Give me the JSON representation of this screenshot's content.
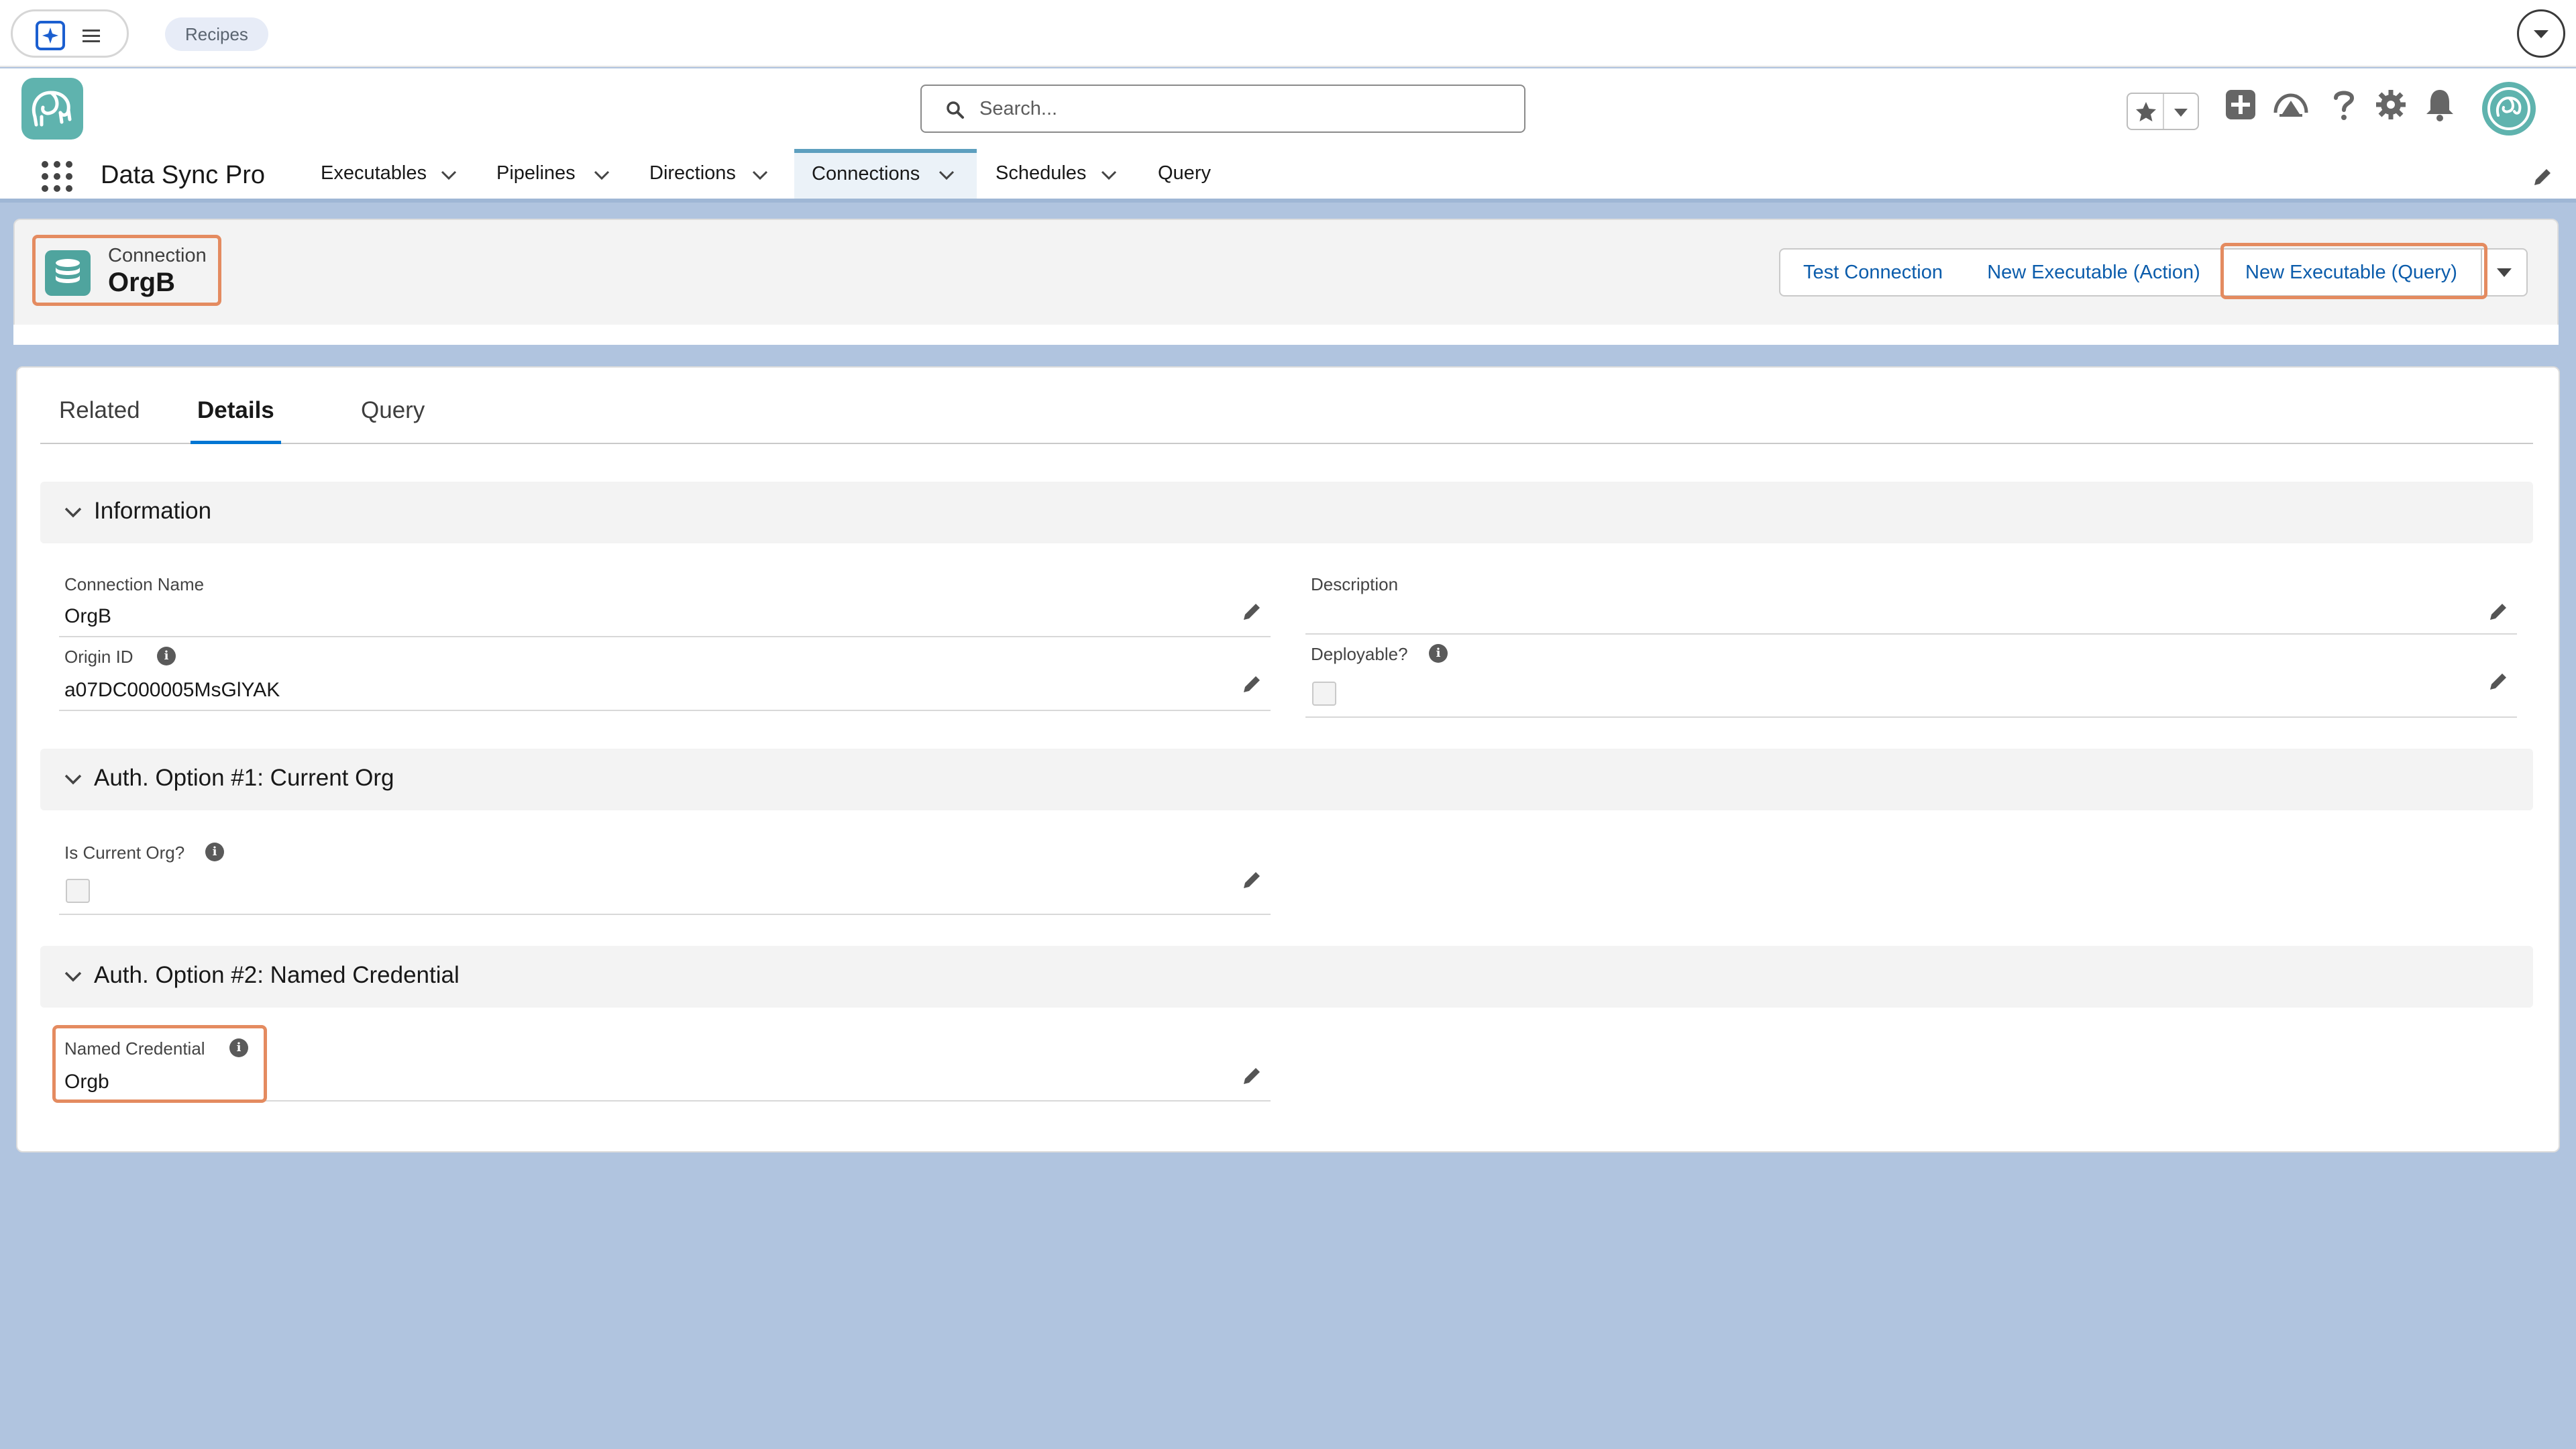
{
  "browser": {
    "chip_label": "Recipes",
    "icons": [
      "extension-logo-icon",
      "menu-icon",
      "chevron-down-icon"
    ]
  },
  "header": {
    "search_placeholder": "Search...",
    "icons": [
      "star-icon",
      "add-icon",
      "trailhead-icon",
      "help-icon",
      "gear-icon",
      "bell-icon"
    ]
  },
  "nav": {
    "app_name": "Data Sync Pro",
    "items": [
      {
        "label": "Executables",
        "has_menu": true,
        "active": false
      },
      {
        "label": "Pipelines",
        "has_menu": true,
        "active": false
      },
      {
        "label": "Directions",
        "has_menu": true,
        "active": false
      },
      {
        "label": "Connections",
        "has_menu": true,
        "active": true
      },
      {
        "label": "Schedules",
        "has_menu": true,
        "active": false
      },
      {
        "label": "Query",
        "has_menu": false,
        "active": false
      }
    ]
  },
  "record": {
    "type_label": "Connection",
    "name": "OrgB",
    "actions": {
      "test": "Test Connection",
      "new_action": "New Executable (Action)",
      "new_query": "New Executable (Query)"
    }
  },
  "tabs": [
    {
      "label": "Related",
      "active": false
    },
    {
      "label": "Details",
      "active": true
    },
    {
      "label": "Query",
      "active": false
    }
  ],
  "sections": {
    "information": {
      "title": "Information",
      "connection_name_label": "Connection Name",
      "connection_name_value": "OrgB",
      "origin_id_label": "Origin ID",
      "origin_id_value": "a07DC000005MsGlYAK",
      "description_label": "Description",
      "description_value": "",
      "deployable_label": "Deployable?",
      "deployable_checked": false
    },
    "auth1": {
      "title": "Auth. Option #1: Current Org",
      "is_current_org_label": "Is Current Org?",
      "is_current_org_checked": false
    },
    "auth2": {
      "title": "Auth. Option #2: Named Credential",
      "named_credential_label": "Named Credential",
      "named_credential_value": "Orgb"
    }
  },
  "colors": {
    "brand_teal": "#5fb3ae",
    "link_blue": "#0b5cab",
    "highlight_orange": "#e48b60",
    "active_tab_blue": "#0176d3",
    "page_bg": "#b0c4df"
  }
}
